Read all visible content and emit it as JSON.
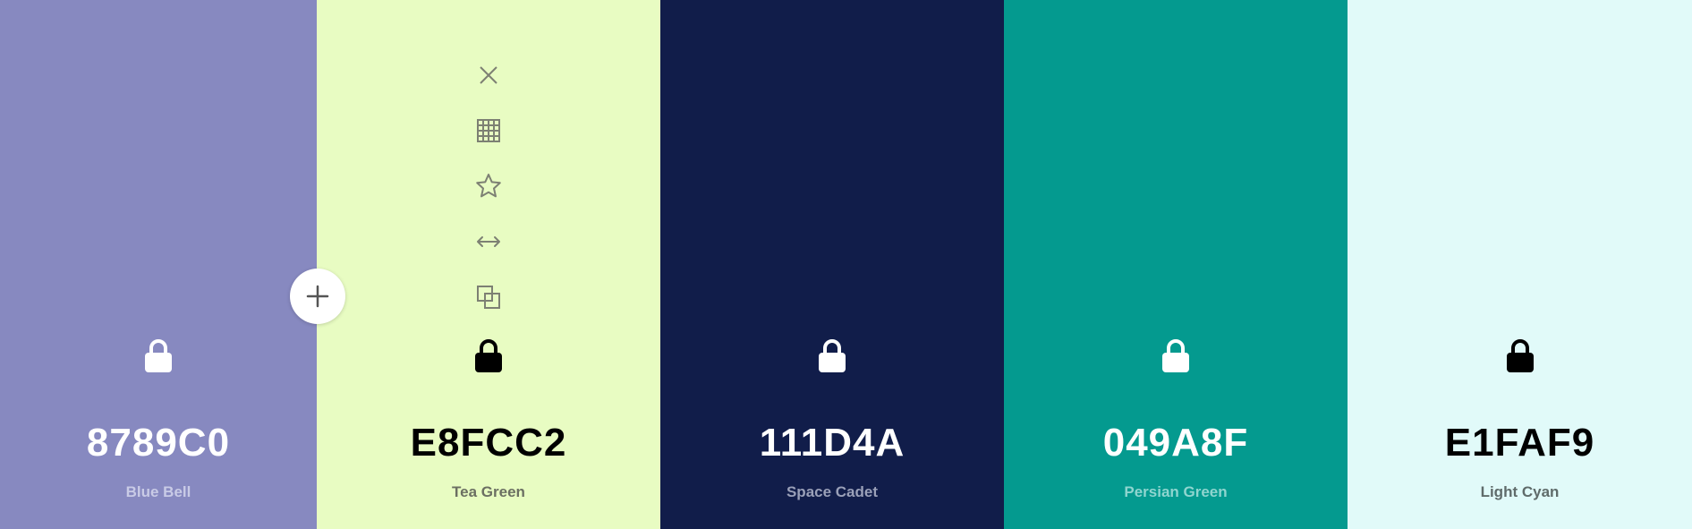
{
  "palette": {
    "add_button_icon": "plus-icon",
    "tools_icons": [
      "close-icon",
      "grid-icon",
      "star-icon",
      "arrows-horizontal-icon",
      "copy-icon"
    ],
    "swatches": [
      {
        "hex": "8789C0",
        "name": "Blue Bell",
        "bg": "#8789C0",
        "text_color": "#ffffff",
        "name_color": "#c9cbe6",
        "lock_color": "#ffffff",
        "locked": false
      },
      {
        "hex": "E8FCC2",
        "name": "Tea Green",
        "bg": "#E8FCC2",
        "text_color": "#000000",
        "name_color": "#6b6f62",
        "lock_color": "#000000",
        "tool_color": "#7d8073",
        "locked": true
      },
      {
        "hex": "111D4A",
        "name": "Space Cadet",
        "bg": "#111D4A",
        "text_color": "#ffffff",
        "name_color": "#9aa0b8",
        "lock_color": "#ffffff",
        "locked": false
      },
      {
        "hex": "049A8F",
        "name": "Persian Green",
        "bg": "#049A8F",
        "text_color": "#ffffff",
        "name_color": "#8fd5cf",
        "lock_color": "#ffffff",
        "locked": false
      },
      {
        "hex": "E1FAF9",
        "name": "Light Cyan",
        "bg": "#E1FAF9",
        "text_color": "#000000",
        "name_color": "#5f6b6a",
        "lock_color": "#000000",
        "locked": false
      }
    ]
  }
}
